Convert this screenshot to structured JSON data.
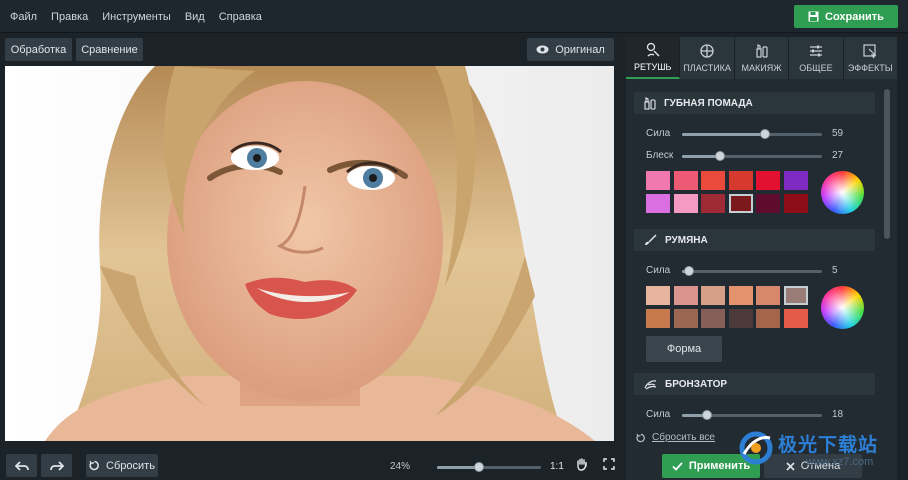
{
  "menu": {
    "items": [
      "Файл",
      "Правка",
      "Инструменты",
      "Вид",
      "Справка"
    ],
    "save_label": "Сохранить"
  },
  "toolbar": {
    "processing_label": "Обработка",
    "compare_label": "Сравнение",
    "original_label": "Оригинал"
  },
  "bottom": {
    "reset_label": "Сбросить",
    "zoom_label": "24%",
    "zoom_fraction": 0.4,
    "ratio_label": "1:1"
  },
  "tabs": [
    {
      "label": "РЕТУШЬ",
      "icon": "retouch-brush-icon",
      "active": true
    },
    {
      "label": "ПЛАСТИКА",
      "icon": "plastic-target-icon",
      "active": false
    },
    {
      "label": "МАКИЯЖ",
      "icon": "makeup-icon",
      "active": false
    },
    {
      "label": "ОБЩЕЕ",
      "icon": "sliders-icon",
      "active": false
    },
    {
      "label": "ЭФФЕКТЫ",
      "icon": "effects-icon",
      "active": false
    }
  ],
  "lipstick": {
    "title": "ГУБНАЯ ПОМАДА",
    "strength_label": "Сила",
    "strength_value": "59",
    "strength_fraction": 0.59,
    "gloss_label": "Блеск",
    "gloss_value": "27",
    "gloss_fraction": 0.27,
    "swatches": [
      "#f279b0",
      "#ee5a74",
      "#ea4a3b",
      "#d63a2e",
      "#e4102f",
      "#7d2bc2",
      "#d96fe1",
      "#f49ac3",
      "#9e2a36",
      "#7a1a1d",
      "#5e0b2d",
      "#8e0d17"
    ],
    "selected_swatch": 9
  },
  "blush": {
    "title": "РУМЯНА",
    "strength_label": "Сила",
    "strength_value": "5",
    "strength_fraction": 0.05,
    "swatches": [
      "#e7b59e",
      "#d9948e",
      "#d89f88",
      "#e5926f",
      "#d8866c",
      "#9a7c76",
      "#c67a4d",
      "#9b6750",
      "#855e58",
      "#4d3a3a",
      "#a4654a",
      "#e45b49"
    ],
    "selected_swatch": 5,
    "shape_label": "Форма"
  },
  "bronzer": {
    "title": "БРОНЗАТОР",
    "strength_label": "Сила",
    "strength_value": "18",
    "strength_fraction": 0.18
  },
  "footer": {
    "reset_all_label": "Сбросить все",
    "apply_label": "Применить",
    "cancel_label": "Отмена"
  },
  "watermark": {
    "text": "极光下载站",
    "url": "www.xz7.com"
  }
}
